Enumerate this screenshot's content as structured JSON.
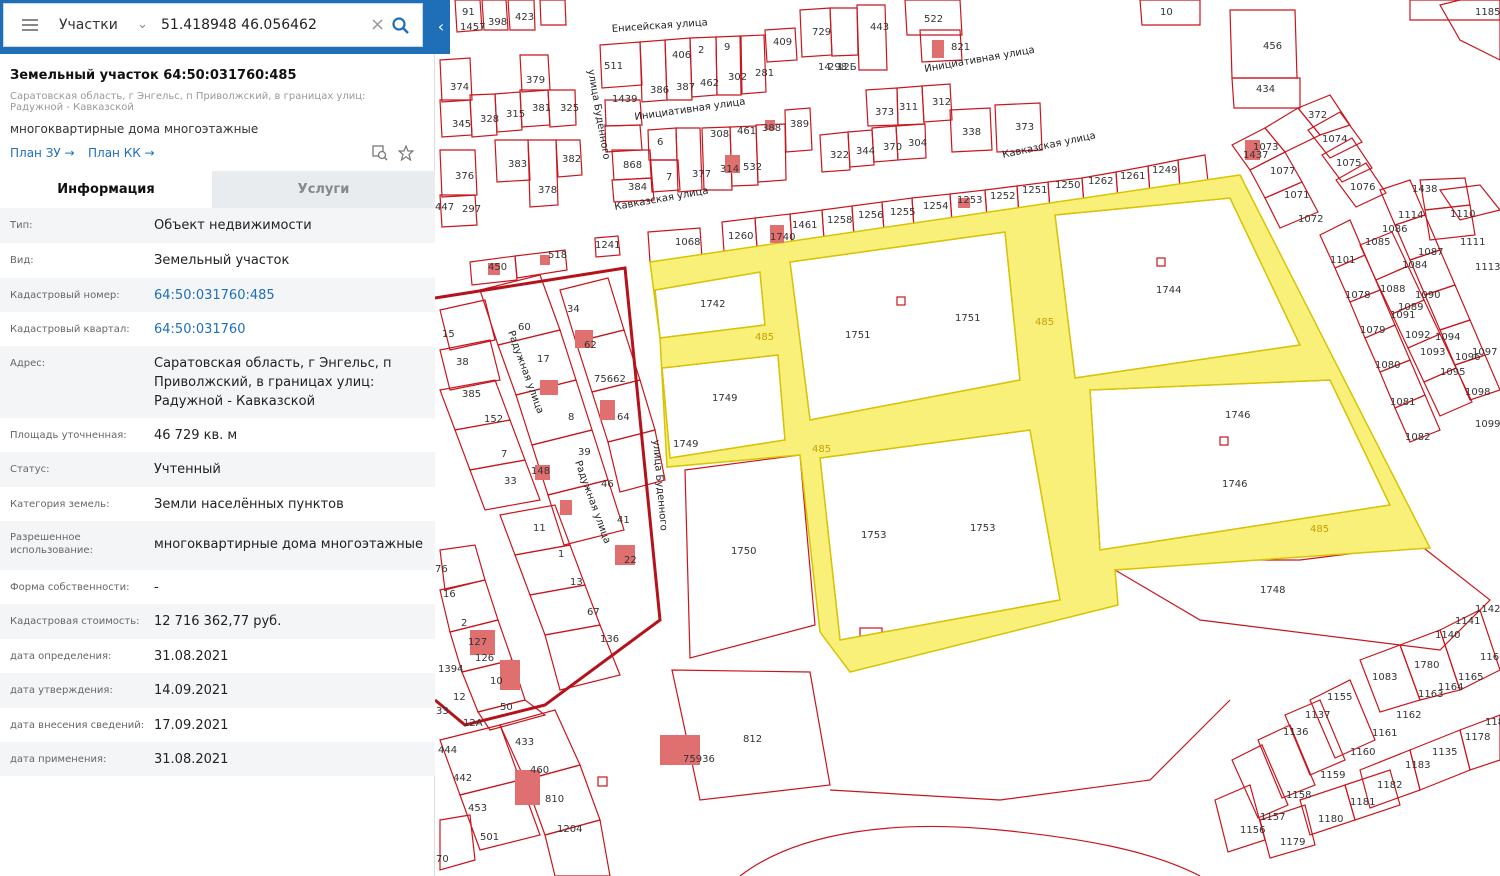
{
  "search": {
    "layer": "Участки",
    "query": "51.418948 46.056462"
  },
  "parcel": {
    "title": "Земельный участок 64:50:031760:485",
    "address_short": "Саратовская область, г Энгельс, п Приволжский, в границах улиц: Радужной - Кавказской",
    "purpose": "многоквартирные дома многоэтажные",
    "link_plan_zu": "План ЗУ →",
    "link_plan_kk": "План КК →"
  },
  "tabs": {
    "info": "Информация",
    "services": "Услуги"
  },
  "info_rows": [
    {
      "key": "Тип:",
      "value": "Объект недвижимости"
    },
    {
      "key": "Вид:",
      "value": "Земельный участок"
    },
    {
      "key": "Кадастровый номер:",
      "value": "64:50:031760:485"
    },
    {
      "key": "Кадастровый квартал:",
      "value": "64:50:031760"
    },
    {
      "key": "Адрес:",
      "value": "Саратовская область, г Энгельс, п Приволжский, в границах улиц: Радужной - Кавказской"
    },
    {
      "key": "Площадь уточненная:",
      "value": "46 729 кв. м"
    },
    {
      "key": "Статус:",
      "value": "Учтенный"
    },
    {
      "key": "Категория земель:",
      "value": "Земли населённых пунктов"
    },
    {
      "key": "Разрешенное использование:",
      "value": "многоквартирные дома многоэтажные"
    },
    {
      "key": "Форма собственности:",
      "value": "-"
    },
    {
      "key": "Кадастровая стоимость:",
      "value": "12 716 362,77 руб."
    },
    {
      "key": "дата определения:",
      "value": "31.08.2021"
    },
    {
      "key": "дата утверждения:",
      "value": "14.09.2021"
    },
    {
      "key": "дата внесения сведений:",
      "value": "17.09.2021"
    },
    {
      "key": "дата применения:",
      "value": "31.08.2021"
    }
  ],
  "map": {
    "streets": [
      "Енисейская улица",
      "Инициативная улица",
      "Инициативная улица",
      "Кавказская улица",
      "Кавказская улица",
      "улица Буденного",
      "улица Будённого",
      "Радужная улица",
      "Радужная улица"
    ],
    "selected_parcel_label": "485",
    "parcel_numbers": [
      "1742",
      "1751",
      "1751",
      "1744",
      "1749",
      "1749",
      "1746",
      "1746",
      "1750",
      "1753",
      "1753",
      "1748",
      "812",
      "1068",
      "1260",
      "1740",
      "1461",
      "1258",
      "1256",
      "1255",
      "1254",
      "1253",
      "1252",
      "1251",
      "1250",
      "1262",
      "1261",
      "1249",
      "450",
      "518",
      "1241",
      "456",
      "434",
      "10",
      "34",
      "60",
      "62",
      "17",
      "75662",
      "8",
      "64",
      "39",
      "46",
      "41",
      "22",
      "15",
      "38",
      "385",
      "152",
      "7",
      "33",
      "148",
      "11",
      "1",
      "13",
      "67",
      "136",
      "433",
      "460",
      "810",
      "1204",
      "444",
      "442",
      "453",
      "501",
      "50",
      "10",
      "126",
      "127",
      "2",
      "16",
      "76",
      "75936",
      "1457",
      "398",
      "423",
      "511",
      "406",
      "2",
      "9",
      "409",
      "729",
      "443",
      "522",
      "821",
      "1439",
      "386",
      "387",
      "462",
      "302",
      "281",
      "14",
      "298",
      "373",
      "311",
      "312",
      "6",
      "7",
      "377",
      "314",
      "532",
      "868",
      "384",
      "308",
      "461",
      "388",
      "389",
      "322",
      "344",
      "370",
      "304",
      "338",
      "373",
      "374",
      "345",
      "328",
      "315",
      "379",
      "381",
      "325",
      "383",
      "378",
      "382",
      "376",
      "297",
      "447",
      "372",
      "1074",
      "1075",
      "1076",
      "1077",
      "1071",
      "1072",
      "1073",
      "1437",
      "1438",
      "1110",
      "1111",
      "1113",
      "1114",
      "1086",
      "1085",
      "1084",
      "1087",
      "1088",
      "1089",
      "1090",
      "1091",
      "1092",
      "1093",
      "1094",
      "1095",
      "1096",
      "1097",
      "1098",
      "1099",
      "1101",
      "1078",
      "1079",
      "1080",
      "1081",
      "1082",
      "1083",
      "1780",
      "1140",
      "1141",
      "1142",
      "1163",
      "1164",
      "1165",
      "1166",
      "1162",
      "1161",
      "1160",
      "1159",
      "1158",
      "1157",
      "1156",
      "1155",
      "1137",
      "1136",
      "1135",
      "1183",
      "1182",
      "1181",
      "1180",
      "1179",
      "1178",
      "1184",
      "1185",
      "1394",
      "12",
      "12А",
      "12Б",
      "33",
      "70",
      "91",
      "37"
    ]
  }
}
